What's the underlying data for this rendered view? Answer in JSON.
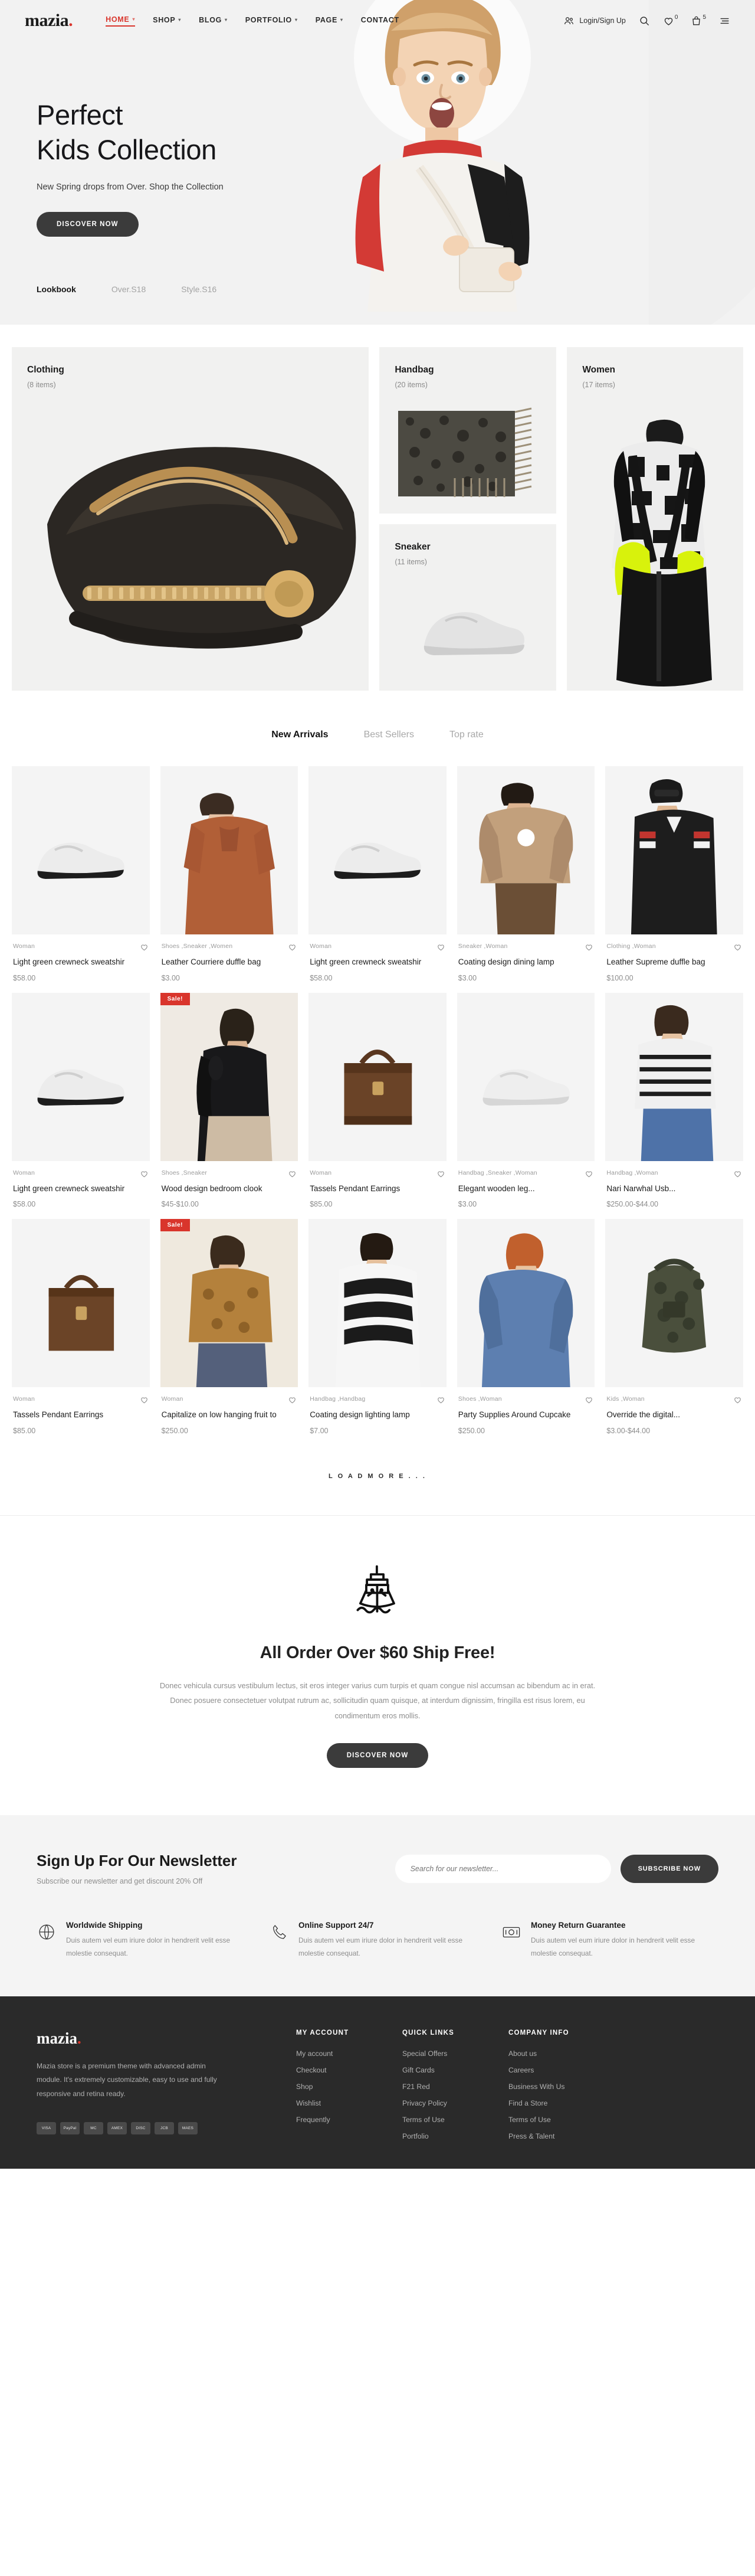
{
  "header": {
    "logo": "mazia",
    "logo_dot": ".",
    "nav": [
      {
        "label": "HOME",
        "has_caret": true,
        "active": true
      },
      {
        "label": "SHOP",
        "has_caret": true,
        "active": false
      },
      {
        "label": "BLOG",
        "has_caret": true,
        "active": false
      },
      {
        "label": "PORTFOLIO",
        "has_caret": true,
        "active": false
      },
      {
        "label": "PAGE",
        "has_caret": true,
        "active": false
      },
      {
        "label": "CONTACT",
        "has_caret": false,
        "active": false
      }
    ],
    "login_label": "Login/Sign Up",
    "wishlist_count": "0",
    "cart_count": "5",
    "accent_color": "#d9352c"
  },
  "hero": {
    "title_line1": "Perfect",
    "title_line2": "Kids Collection",
    "subtitle": "New Spring drops from Over. Shop the Collection",
    "cta": "DISCOVER NOW",
    "tabs": [
      {
        "label": "Lookbook",
        "active": true
      },
      {
        "label": "Over.S18",
        "active": false
      },
      {
        "label": "Style.S16",
        "active": false
      }
    ]
  },
  "categories": [
    {
      "name": "Clothing",
      "count": "(8 items)"
    },
    {
      "name": "Handbag",
      "count": "(20 items)"
    },
    {
      "name": "Sneaker",
      "count": "(11 items)"
    },
    {
      "name": "Women",
      "count": "(17 items)"
    }
  ],
  "products": {
    "tabs": [
      {
        "label": "New Arrivals",
        "active": true
      },
      {
        "label": "Best Sellers",
        "active": false
      },
      {
        "label": "Top rate",
        "active": false
      }
    ],
    "load_more": "L O A D   M O R E . . .",
    "items": [
      {
        "cats": "Woman",
        "title": "Light green crewneck sweatshir",
        "price": "$58.00",
        "sale": false
      },
      {
        "cats": "Shoes ,Sneaker ,Women",
        "title": "Leather Courriere duffle bag",
        "price": "$3.00",
        "sale": false
      },
      {
        "cats": "Woman",
        "title": "Light green crewneck sweatshir",
        "price": "$58.00",
        "sale": false
      },
      {
        "cats": "Sneaker ,Woman",
        "title": "Coating design dining lamp",
        "price": "$3.00",
        "sale": false
      },
      {
        "cats": "Clothing ,Woman",
        "title": "Leather Supreme duffle bag",
        "price": "$100.00",
        "sale": false
      },
      {
        "cats": "Woman",
        "title": "Light green crewneck sweatshir",
        "price": "$58.00",
        "sale": false
      },
      {
        "cats": "Shoes ,Sneaker",
        "title": "Wood design bedroom clook",
        "price": "$45-$10.00",
        "sale": true
      },
      {
        "cats": "Woman",
        "title": "Tassels Pendant Earrings",
        "price": "$85.00",
        "sale": false
      },
      {
        "cats": "Handbag ,Sneaker ,Woman",
        "title": "Elegant wooden leg...",
        "price": "$3.00",
        "sale": false
      },
      {
        "cats": "Handbag ,Woman",
        "title": "Nari Narwhal Usb...",
        "price": "$250.00-$44.00",
        "sale": false
      },
      {
        "cats": "Woman",
        "title": "Tassels Pendant Earrings",
        "price": "$85.00",
        "sale": false
      },
      {
        "cats": "Woman",
        "title": "Capitalize on low hanging fruit to",
        "price": "$250.00",
        "sale": true
      },
      {
        "cats": "Handbag ,Handbag",
        "title": "Coating design lighting lamp",
        "price": "$7.00",
        "sale": false
      },
      {
        "cats": "Shoes ,Woman",
        "title": "Party Supplies Around Cupcake",
        "price": "$250.00",
        "sale": false
      },
      {
        "cats": "Kids ,Woman",
        "title": "Override the digital...",
        "price": "$3.00-$44.00",
        "sale": false
      }
    ],
    "sale_label": "Sale!"
  },
  "ship": {
    "title": "All Order Over $60 Ship Free!",
    "paragraph": "Donec vehicula cursus vestibulum lectus, sit eros integer varius cum turpis et quam congue nisl accumsan ac bibendum ac in erat. Donec posuere consectetuer volutpat rutrum ac, sollicitudin quam quisque, at interdum dignissim, fringilla est risus lorem, eu condimentum eros mollis.",
    "cta": "DISCOVER NOW"
  },
  "newsletter": {
    "title": "Sign Up For Our Newsletter",
    "subtitle": "Subscribe our newsletter and get discount 20% Off",
    "placeholder": "Search for our newsletter...",
    "button": "SUBSCRIBE NOW"
  },
  "features": [
    {
      "icon": "globe-icon",
      "title": "Worldwide Shipping",
      "desc": "Duis autem vel eum iriure dolor in hendrerit velit esse molestie consequat."
    },
    {
      "icon": "phone-icon",
      "title": "Online Support 24/7",
      "desc": "Duis autem vel eum iriure dolor in hendrerit velit esse molestie consequat."
    },
    {
      "icon": "money-return-icon",
      "title": "Money Return Guarantee",
      "desc": "Duis autem vel eum iriure dolor in hendrerit velit esse molestie consequat."
    }
  ],
  "footer": {
    "logo": "mazia",
    "logo_dot": ".",
    "desc": "Mazia store is a premium theme with advanced admin module. It's extremely customizable, easy to use and fully responsive and retina ready.",
    "columns": [
      {
        "heading": "MY ACCOUNT",
        "links": [
          "My account",
          "Checkout",
          "Shop",
          "Wishlist",
          "Frequently"
        ]
      },
      {
        "heading": "QUICK LINKS",
        "links": [
          "Special Offers",
          "Gift Cards",
          "F21 Red",
          "Privacy Policy",
          "Terms of Use",
          "Portfolio"
        ]
      },
      {
        "heading": "COMPANY INFO",
        "links": [
          "About us",
          "Careers",
          "Business With Us",
          "Find a Store",
          "Terms of Use",
          "Press & Talent"
        ]
      }
    ],
    "payments": [
      "VISA",
      "PayPal",
      "MC",
      "AMEX",
      "DISC",
      "JCB",
      "MAES"
    ]
  }
}
